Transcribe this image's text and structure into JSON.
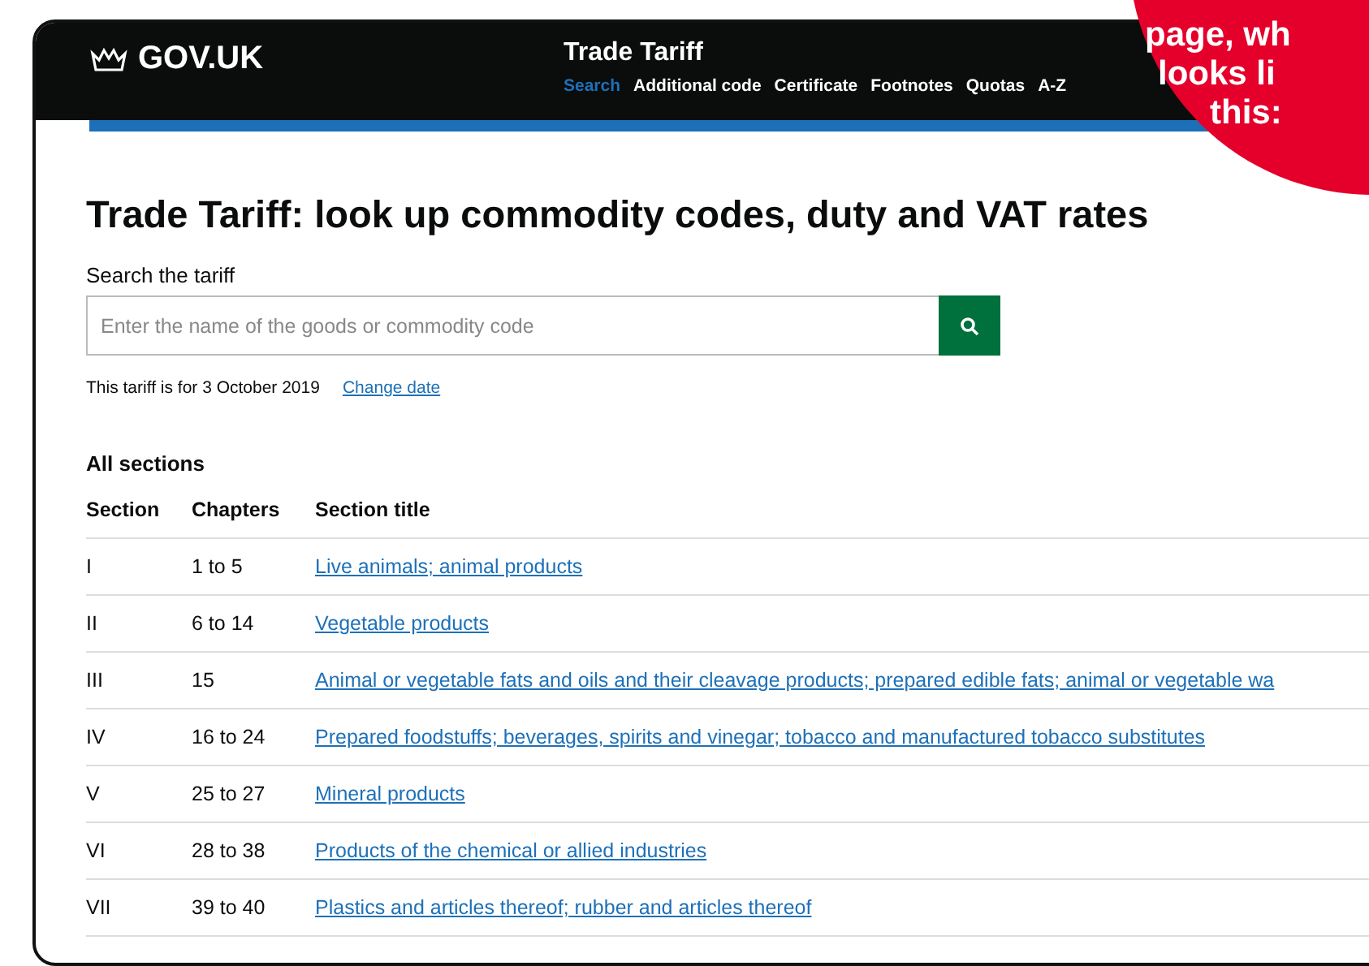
{
  "header": {
    "logo": "GOV.UK",
    "service": "Trade Tariff",
    "nav": [
      {
        "label": "Search",
        "selected": true
      },
      {
        "label": "Additional code",
        "selected": false
      },
      {
        "label": "Certificate",
        "selected": false
      },
      {
        "label": "Footnotes",
        "selected": false
      },
      {
        "label": "Quotas",
        "selected": false
      },
      {
        "label": "A-Z",
        "selected": false
      }
    ]
  },
  "heading": "Trade Tariff: look up commodity codes, duty and VAT rates",
  "search": {
    "label": "Search the tariff",
    "placeholder": "Enter the name of the goods or commodity code"
  },
  "date_note": {
    "text": "This tariff is for 3 October 2019",
    "link": "Change date"
  },
  "sections_title": "All sections",
  "table": {
    "columns": [
      "Section",
      "Chapters",
      "Section title"
    ],
    "rows": [
      {
        "section": "I",
        "chapters": "1 to 5",
        "title": "Live animals; animal products"
      },
      {
        "section": "II",
        "chapters": "6 to 14",
        "title": "Vegetable products"
      },
      {
        "section": "III",
        "chapters": "15",
        "title": "Animal or vegetable fats and oils and their cleavage products; prepared edible fats; animal or vegetable wa"
      },
      {
        "section": "IV",
        "chapters": "16 to 24",
        "title": "Prepared foodstuffs; beverages, spirits and vinegar; tobacco and manufactured tobacco substitutes"
      },
      {
        "section": "V",
        "chapters": "25 to 27",
        "title": "Mineral products"
      },
      {
        "section": "VI",
        "chapters": "28 to 38",
        "title": "Products of the chemical or allied industries"
      },
      {
        "section": "VII",
        "chapters": "39 to 40",
        "title": "Plastics and articles thereof; rubber and articles thereof"
      }
    ]
  },
  "callout": {
    "lines": [
      "page, wh",
      "looks li",
      "this:"
    ]
  }
}
